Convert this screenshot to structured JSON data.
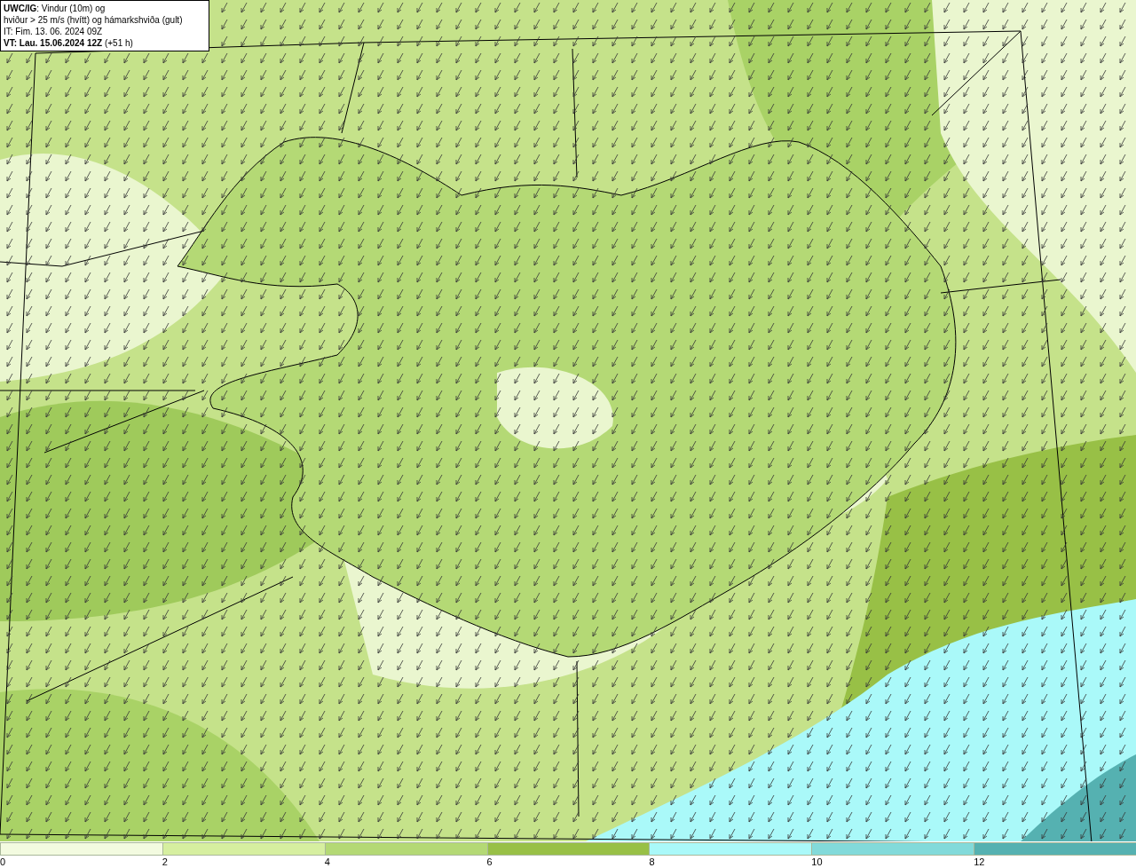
{
  "info_box": {
    "lines": [
      "**UWC/IG**: Vindur (10m) og",
      "hviður > 25 m/s (hvítt) og hámarkshviða (gult)",
      "IT: Fim. 13. 06. 2024 09Z",
      "**VT: Lau. 15.06.2024 12Z** (+51 h)"
    ]
  },
  "colorbar": [
    {
      "label": "0",
      "color": "#f3fbe0"
    },
    {
      "label": "2",
      "color": "#d6efa0"
    },
    {
      "label": "4",
      "color": "#b4d975"
    },
    {
      "label": "6",
      "color": "#98c046"
    },
    {
      "label": "8",
      "color": "#aaf9f9"
    },
    {
      "label": "10",
      "color": "#82dada"
    },
    {
      "label": "12",
      "color": "#55b1b1"
    }
  ]
}
